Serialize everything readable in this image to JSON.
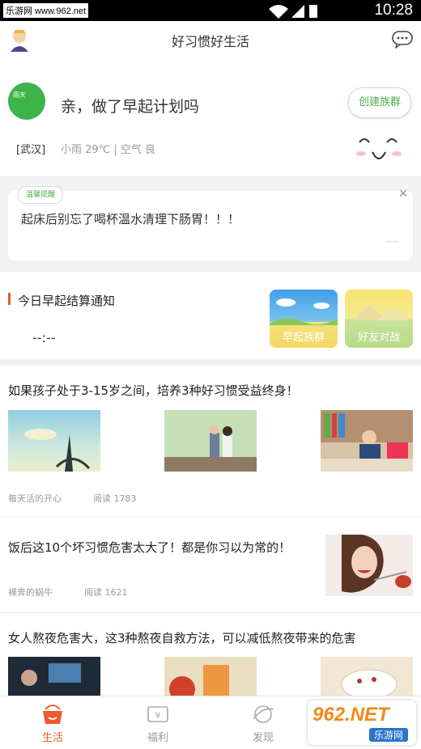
{
  "statusbar": {
    "watermark": "乐游网 www.962.net",
    "time": "10:28"
  },
  "header": {
    "title": "好习惯好生活"
  },
  "plan": {
    "weather_logo_text": "雨天",
    "greeting": "亲，做了早起计划吗",
    "create_group": "创建族群",
    "city": "[武汉]",
    "weather": "小雨 29℃ | 空气 良"
  },
  "tip": {
    "badge": "温馨提醒",
    "text": "起床后别忘了喝杯温水清理下肠胃！！！",
    "time": "--:--"
  },
  "notice": {
    "title": "今日早起结算通知",
    "time": "--:--",
    "cards": [
      {
        "label": "早起族群"
      },
      {
        "label": "好友对战"
      }
    ]
  },
  "articles": [
    {
      "title": "如果孩子处于3-15岁之间，培养3种好习惯受益终身！",
      "author": "每天活的开心",
      "reads": "阅读 1783"
    },
    {
      "title": "饭后这10个坏习惯危害太大了！都是你习以为常的！",
      "author": "裸奔的蜗牛",
      "reads": "阅读 1621"
    },
    {
      "title": "女人熬夜危害大，这3种熬夜自救方法，可以减低熬夜带来的危害"
    }
  ],
  "tabs": [
    {
      "label": "生活",
      "icon": "life-icon",
      "active": true
    },
    {
      "label": "福利",
      "icon": "welfare-icon"
    },
    {
      "label": "发现",
      "icon": "discover-icon"
    }
  ],
  "promo": {
    "brand": "962.NET",
    "site": "乐游网"
  },
  "colors": {
    "accent": "#ea5a2e",
    "green": "#4cae4c",
    "bg_gray": "#f2f2f2"
  }
}
